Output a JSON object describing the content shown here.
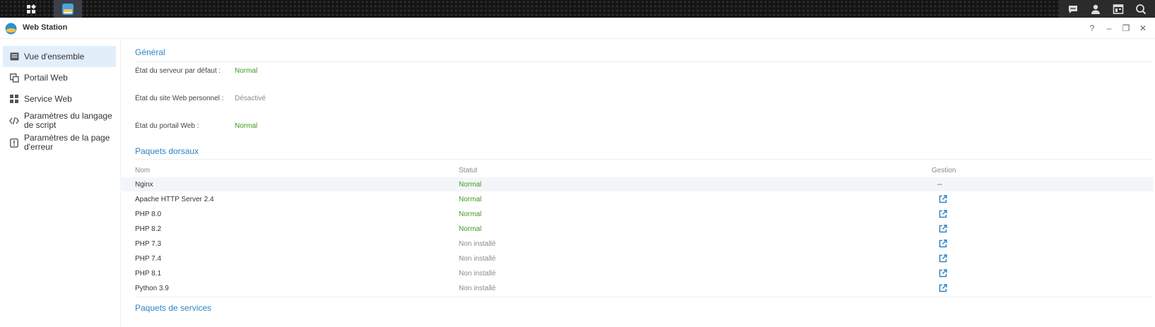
{
  "window": {
    "title": "Web Station"
  },
  "window_controls": {
    "help": "?",
    "minimize": "–",
    "restore": "❐",
    "close": "✕"
  },
  "sidebar": {
    "items": [
      {
        "label": "Vue d'ensemble",
        "icon": "overview-icon",
        "active": true
      },
      {
        "label": "Portail Web",
        "icon": "portal-icon"
      },
      {
        "label": "Service Web",
        "icon": "grid-icon"
      },
      {
        "label": "Paramètres du langage de script",
        "icon": "code-icon"
      },
      {
        "label": "Paramètres de la page d'erreur",
        "icon": "alert-icon"
      }
    ]
  },
  "general": {
    "title": "Général",
    "rows": [
      {
        "label": "État du serveur par défaut :",
        "value": "Normal",
        "status": "ok"
      },
      {
        "label": "État du site Web personnel :",
        "value": "Désactivé",
        "status": "off"
      },
      {
        "label": "État du portail Web :",
        "value": "Normal",
        "status": "ok"
      }
    ]
  },
  "backend": {
    "title": "Paquets dorsaux",
    "columns": {
      "name": "Nom",
      "status": "Statut",
      "manage": "Gestion"
    },
    "rows": [
      {
        "name": "Nginx",
        "status": "Normal",
        "manage": "--"
      },
      {
        "name": "Apache HTTP Server 2.4",
        "status": "Normal",
        "manage": "open-external-icon"
      },
      {
        "name": "PHP 8.0",
        "status": "Normal",
        "manage": "open-external-icon"
      },
      {
        "name": "PHP 8.2",
        "status": "Normal",
        "manage": "open-external-icon"
      },
      {
        "name": "PHP 7.3",
        "status": "Non installé",
        "manage": "open-external-icon"
      },
      {
        "name": "PHP 7.4",
        "status": "Non installé",
        "manage": "open-external-icon"
      },
      {
        "name": "PHP 8.1",
        "status": "Non installé",
        "manage": "open-external-icon"
      },
      {
        "name": "Python 3.9",
        "status": "Non installé",
        "manage": "open-external-icon"
      }
    ]
  },
  "services": {
    "title": "Paquets de services"
  },
  "colors": {
    "accent": "#2d84c6",
    "ok": "#3c9b1a",
    "muted": "#8a8a8a",
    "active_bg": "#e3eefb"
  }
}
